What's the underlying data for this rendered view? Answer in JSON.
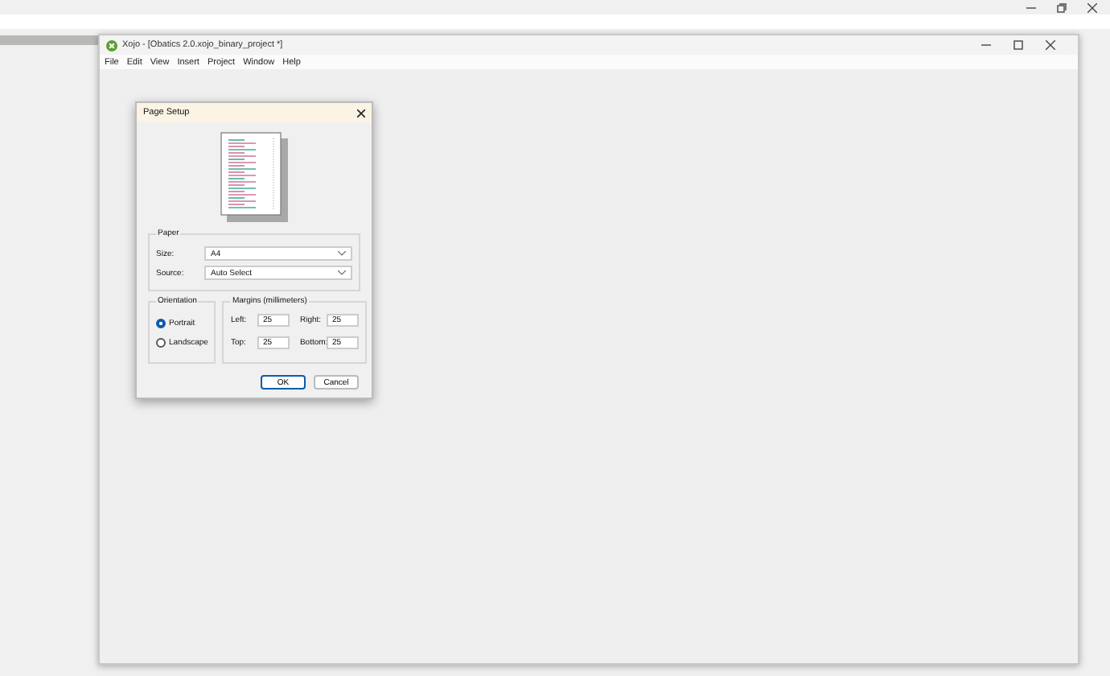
{
  "window": {
    "title": "Xojo - [Obatics 2.0.xojo_binary_project *]"
  },
  "menu": [
    "File",
    "Edit",
    "View",
    "Insert",
    "Project",
    "Window",
    "Help"
  ],
  "dialog": {
    "title": "Page Setup",
    "paper": {
      "heading": "Paper",
      "size_label": "Size:",
      "size_value": "A4",
      "source_label": "Source:",
      "source_value": "Auto Select"
    },
    "orientation": {
      "heading": "Orientation",
      "options": [
        {
          "label": "Portrait",
          "selected": true
        },
        {
          "label": "Landscape",
          "selected": false
        }
      ]
    },
    "margins": {
      "heading": "Margins (millimeters)",
      "fields": [
        {
          "label": "Left:",
          "value": "25"
        },
        {
          "label": "Right:",
          "value": "25"
        },
        {
          "label": "Top:",
          "value": "25"
        },
        {
          "label": "Bottom:",
          "value": "25"
        }
      ]
    },
    "buttons": [
      {
        "label": "OK",
        "default": true
      },
      {
        "label": "Cancel",
        "default": false
      }
    ]
  }
}
